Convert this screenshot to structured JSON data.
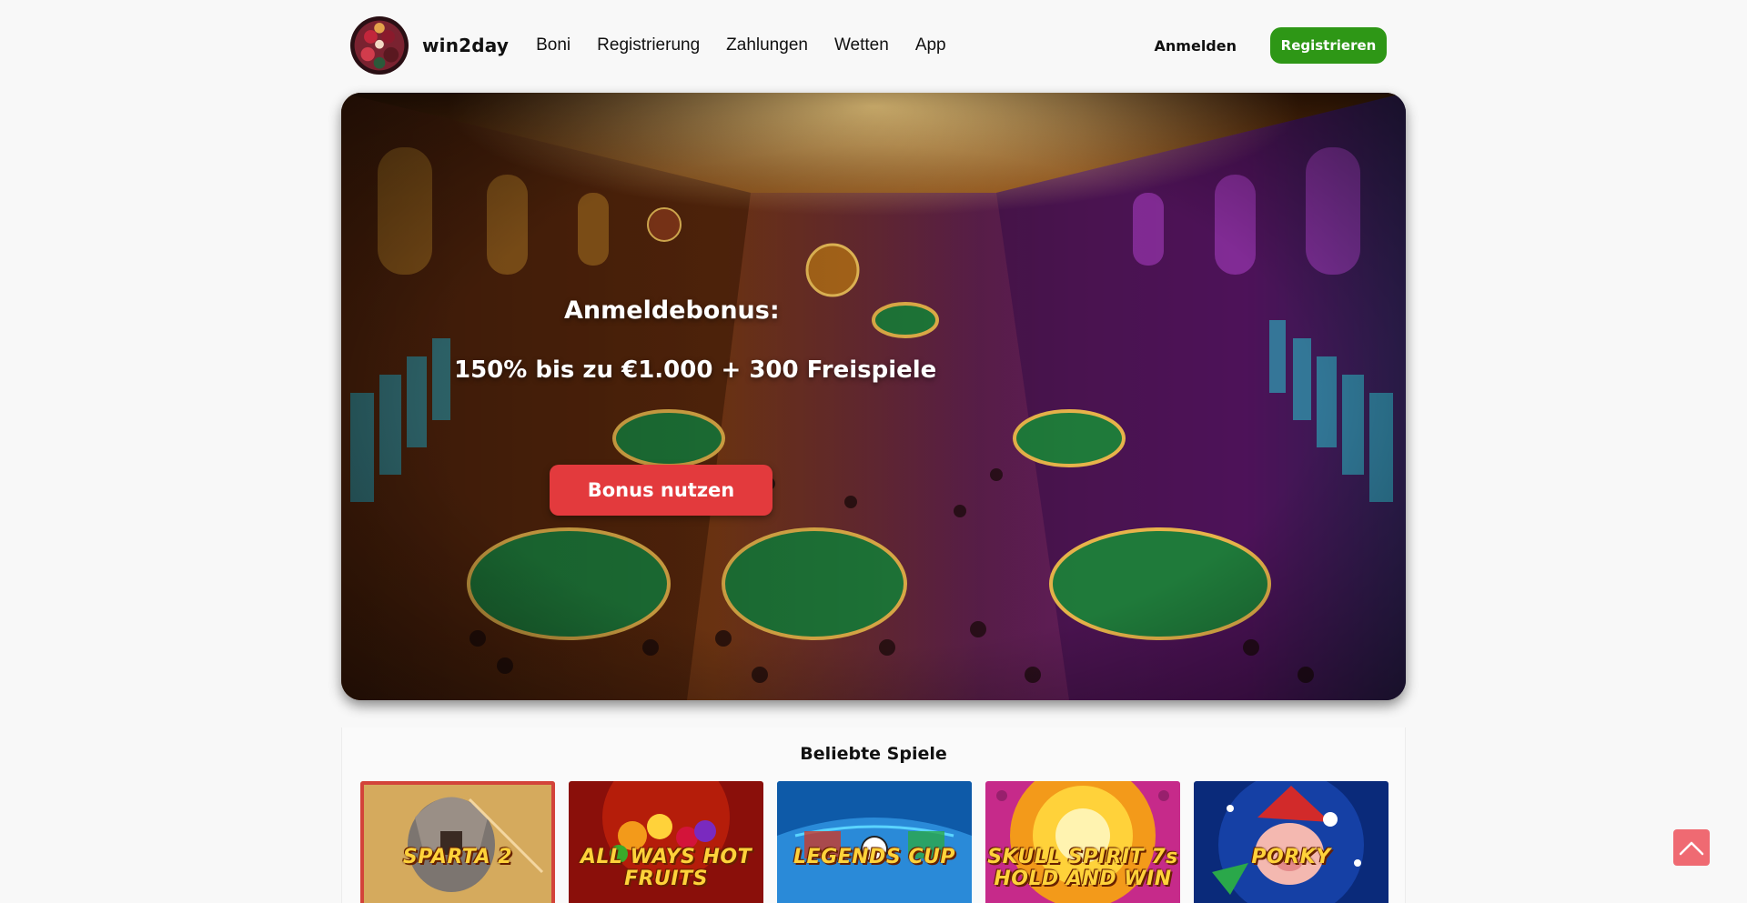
{
  "header": {
    "brand": "win2day",
    "nav": [
      "Boni",
      "Registrierung",
      "Zahlungen",
      "Wetten",
      "App"
    ],
    "login_label": "Anmelden",
    "register_label": "Registrieren"
  },
  "hero": {
    "title": "Anmeldebonus:",
    "subtitle": "150% bis zu €1.000 + 300 Freispiele",
    "cta_label": "Bonus nutzen"
  },
  "games": {
    "title": "Beliebte Spiele",
    "items": [
      {
        "name": "SPARTA 2"
      },
      {
        "name": "ALL WAYS HOT FRUITS"
      },
      {
        "name": "LEGENDS CUP"
      },
      {
        "name": "SKULL SPIRIT 7s HOLD AND WIN"
      },
      {
        "name": "PORKY"
      }
    ]
  },
  "colors": {
    "register_green": "#2e9716",
    "bonus_red": "#e33a3d",
    "scroll_top": "#ef6a72"
  },
  "icons": {
    "scroll_top": "chevron-up-icon"
  }
}
